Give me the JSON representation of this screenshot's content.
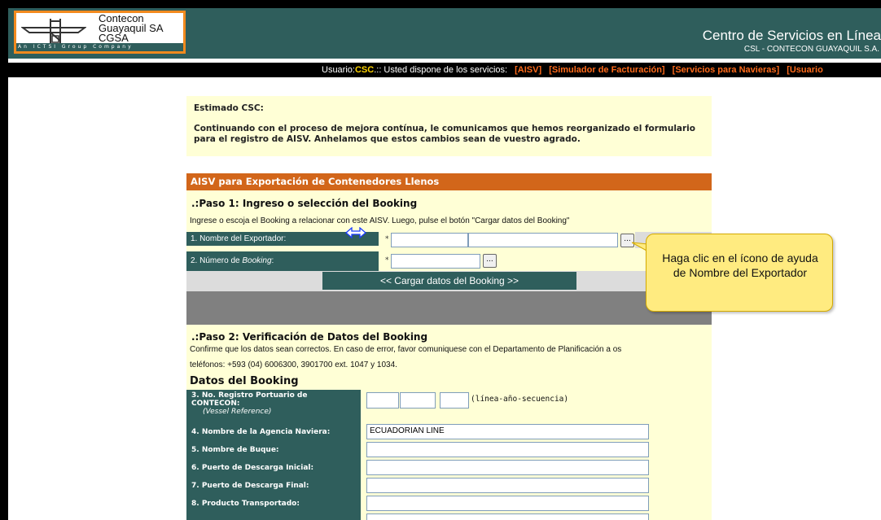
{
  "header": {
    "logo_lines": [
      "Contecon",
      "Guayaquil SA",
      "CGSA"
    ],
    "logo_tagline": "An ICTSI Group Company",
    "title": "Centro de Servicios en Línea",
    "subtitle": "CSL - CONTECON GUAYAQUIL S.A."
  },
  "userbar": {
    "prefix": "Usuario:",
    "user": "CSC",
    "suffix": ".:: Usted dispone de los servicios:",
    "services": [
      "[AISV]",
      "[Simulador de Facturación]",
      "[Servicios para Navieras]",
      "[Usuario"
    ]
  },
  "notice": {
    "greeting": "Estimado CSC:",
    "body": "Continuando con el proceso de mejora contínua, le comunicamos que hemos reorganizado el formulario para el registro de AISV. Anhelamos que estos cambios sean de vuestro agrado."
  },
  "form": {
    "header": "AISV para Exportación de Contenedores Llenos",
    "step1": {
      "title": ".:Paso 1: Ingreso o selección del Booking",
      "desc": "Ingrese o escoja el Booking a relacionar con este AISV. Luego, pulse el botón \"Cargar datos del Booking\"",
      "label1": "1. Nombre del Exportador:",
      "label2_prefix": "2. Número de ",
      "label2_em": "Booking",
      "label2_suffix": ":",
      "required_mark": "*",
      "dots": "...",
      "button": "<< Cargar datos del Booking >>"
    },
    "step2": {
      "title": ".:Paso 2: Verificación de Datos del Booking",
      "desc1": "Confirme que los datos sean correctos. En caso de error, favor comuniquese con el Departamento de Planificación a os",
      "desc2": "teléfonos: +593 (04) 6006300, 3901700 ext. 1047 y 1034."
    },
    "datos": {
      "title": "Datos del Booking",
      "field3_line1": "3. No. Registro Portuario de",
      "field3_line2": "CONTECON:",
      "field3_line3": "(Vessel Reference)",
      "field3_hint": "(línea-año-secuencia)",
      "field4": "4. Nombre de la Agencia Naviera:",
      "field4_value": "ECUADORIAN LINE",
      "field5": "5. Nombre de Buque:",
      "field6": "6. Puerto de Descarga Inicial:",
      "field7": "7. Puerto de Descarga Final:",
      "field8": "8. Producto Transportado:"
    }
  },
  "callout": {
    "text": "Haga clic en el ícono de ayuda de Nombre del Exportador",
    "color": "#ffeb80"
  },
  "colors": {
    "teal": "#2f5e5c",
    "orange": "#d2661a",
    "cream": "#ffffd6",
    "brand_orange": "#f28a1e"
  }
}
